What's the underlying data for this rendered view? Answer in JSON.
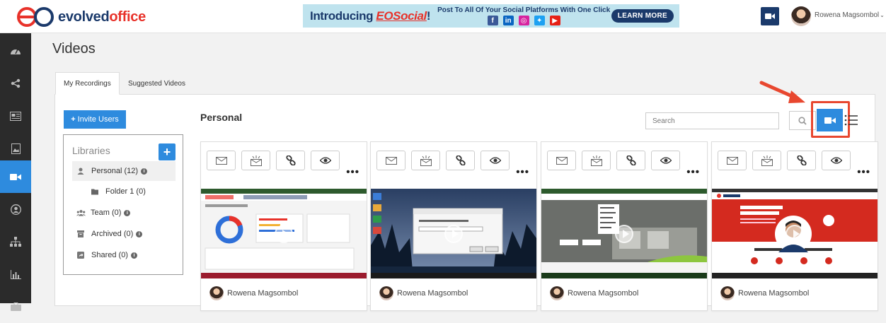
{
  "header": {
    "logo_evolved": "evolved",
    "logo_office": "office",
    "banner": {
      "title_prefix": "Introducing ",
      "title_brand": "EOSocial",
      "title_suffix": "!",
      "subtitle": "Post To All Of Your Social Platforms With One Click",
      "cta": "LEARN MORE",
      "social_icons": [
        "facebook-icon",
        "linkedin-icon",
        "instagram-icon",
        "twitter-icon",
        "youtube-icon"
      ]
    },
    "user_name": "Rowena Magsombol"
  },
  "sidebar": {
    "items": [
      "dashboard-icon",
      "share-icon",
      "newspaper-icon",
      "image-icon",
      "video-camera-icon",
      "user-circle-icon",
      "org-chart-icon",
      "bar-chart-icon",
      "briefcase-icon"
    ],
    "active_index": 4
  },
  "page": {
    "title": "Videos",
    "tabs": [
      {
        "label": "My Recordings",
        "active": true
      },
      {
        "label": "Suggested Videos",
        "active": false
      }
    ]
  },
  "left_panel": {
    "invite_label": "Invite Users",
    "libraries_title": "Libraries",
    "items": [
      {
        "label": "Personal (12)",
        "icon": "user-icon",
        "selected": true
      },
      {
        "label": "Folder 1 (0)",
        "icon": "folder-icon",
        "selected": false
      },
      {
        "label": "Team (0)",
        "icon": "users-icon",
        "selected": false
      },
      {
        "label": "Archived (0)",
        "icon": "archive-icon",
        "selected": false
      },
      {
        "label": "Shared (0)",
        "icon": "share-square-icon",
        "selected": false
      }
    ]
  },
  "content": {
    "section_title": "Personal",
    "search_placeholder": "Search",
    "cards": [
      {
        "owner": "Rowena Magsombol"
      },
      {
        "owner": "Rowena Magsombol"
      },
      {
        "owner": "Rowena Magsombol"
      },
      {
        "owner": "Rowena Magsombol"
      }
    ]
  },
  "colors": {
    "accent_blue": "#2e8bde",
    "navy": "#1b3a6b",
    "brand_red": "#e8322a",
    "highlight": "#e8472f",
    "sidebar_bg": "#2b2b2b"
  }
}
